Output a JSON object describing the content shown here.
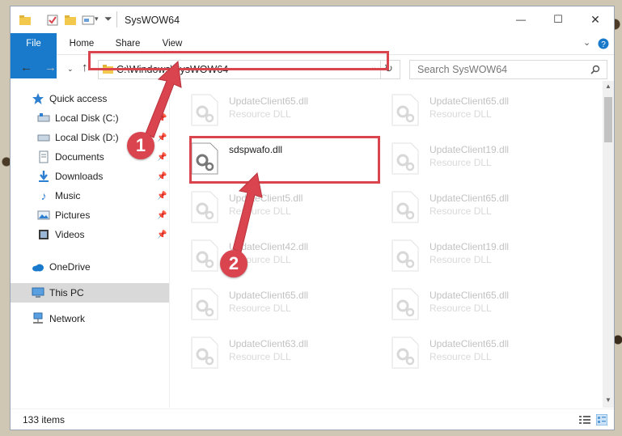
{
  "window": {
    "title": "SysWOW64",
    "controls": {
      "minimize": "—",
      "maximize": "☐",
      "close": "✕"
    }
  },
  "ribbon": {
    "tabs": [
      "File",
      "Home",
      "Share",
      "View"
    ],
    "expand_icon": "chevron-down-icon",
    "help_icon": "help-icon"
  },
  "nav": {
    "address": "C:\\Windows\\SysWOW64",
    "search_placeholder": "Search SysWOW64"
  },
  "sidebar": {
    "items": [
      {
        "label": "Quick access",
        "icon": "star-icon",
        "pinned": false
      },
      {
        "label": "Local Disk (C:)",
        "icon": "drive-icon",
        "pinned": true
      },
      {
        "label": "Local Disk (D:)",
        "icon": "drive-icon",
        "pinned": true
      },
      {
        "label": "Documents",
        "icon": "documents-icon",
        "pinned": true
      },
      {
        "label": "Downloads",
        "icon": "downloads-icon",
        "pinned": true
      },
      {
        "label": "Music",
        "icon": "music-icon",
        "pinned": true
      },
      {
        "label": "Pictures",
        "icon": "pictures-icon",
        "pinned": true
      },
      {
        "label": "Videos",
        "icon": "videos-icon",
        "pinned": true
      },
      {
        "label": "OneDrive",
        "icon": "cloud-icon",
        "pinned": false
      },
      {
        "label": "This PC",
        "icon": "computer-icon",
        "pinned": false,
        "selected": true
      },
      {
        "label": "Network",
        "icon": "network-icon",
        "pinned": false
      }
    ]
  },
  "files": {
    "left": [
      {
        "name": "UpdateClient65.dll",
        "type": "Resource DLL",
        "faded": true
      },
      {
        "name": "sdspwafo.dll",
        "type": "",
        "faded": false
      },
      {
        "name": "UpdateClient5.dll",
        "type": "Resource DLL",
        "faded": true
      },
      {
        "name": "UpdateClient42.dll",
        "type": "Resource DLL",
        "faded": true
      },
      {
        "name": "UpdateClient65.dll",
        "type": "Resource DLL",
        "faded": true
      },
      {
        "name": "UpdateClient63.dll",
        "type": "Resource DLL",
        "faded": true
      }
    ],
    "right": [
      {
        "name": "UpdateClient65.dll",
        "type": "Resource DLL",
        "faded": true
      },
      {
        "name": "UpdateClient19.dll",
        "type": "Resource DLL",
        "faded": true
      },
      {
        "name": "UpdateClient65.dll",
        "type": "Resource DLL",
        "faded": true
      },
      {
        "name": "UpdateClient19.dll",
        "type": "Resource DLL",
        "faded": true
      },
      {
        "name": "UpdateClient65.dll",
        "type": "Resource DLL",
        "faded": true
      },
      {
        "name": "UpdateClient65.dll",
        "type": "Resource DLL",
        "faded": true
      }
    ]
  },
  "status": {
    "item_count": "133 items"
  },
  "annotations": {
    "step1": "1",
    "step2": "2",
    "color": "#d9444f"
  }
}
